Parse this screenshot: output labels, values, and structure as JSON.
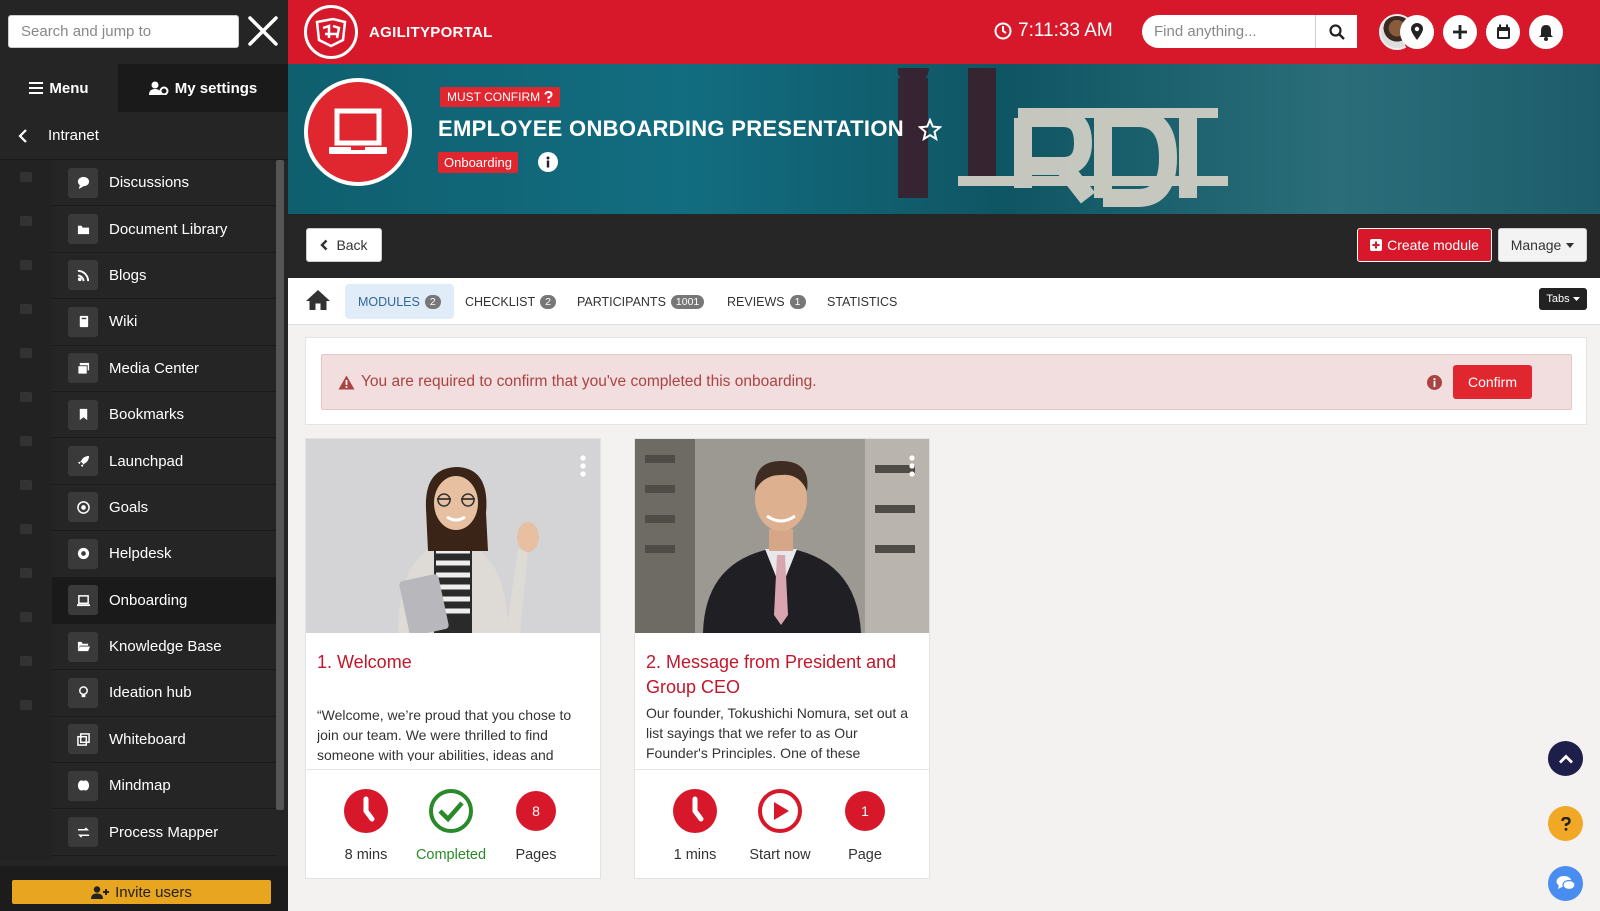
{
  "sidebar": {
    "search_placeholder": "Search and jump to",
    "tab_menu": "Menu",
    "tab_settings": "My settings",
    "breadcrumb": "Intranet",
    "items": [
      {
        "label": "Discussions",
        "icon": "chat-bubble-icon"
      },
      {
        "label": "Document Library",
        "icon": "folder-icon"
      },
      {
        "label": "Blogs",
        "icon": "rss-icon"
      },
      {
        "label": "Wiki",
        "icon": "book-icon"
      },
      {
        "label": "Media Center",
        "icon": "images-icon"
      },
      {
        "label": "Bookmarks",
        "icon": "bookmark-icon"
      },
      {
        "label": "Launchpad",
        "icon": "rocket-icon"
      },
      {
        "label": "Goals",
        "icon": "target-icon"
      },
      {
        "label": "Helpdesk",
        "icon": "lifebuoy-icon"
      },
      {
        "label": "Onboarding",
        "icon": "laptop-icon",
        "active": true
      },
      {
        "label": "Knowledge Base",
        "icon": "folder-open-icon"
      },
      {
        "label": "Ideation hub",
        "icon": "lightbulb-icon"
      },
      {
        "label": "Whiteboard",
        "icon": "clone-icon"
      },
      {
        "label": "Mindmap",
        "icon": "brain-icon"
      },
      {
        "label": "Process Mapper",
        "icon": "exchange-icon"
      }
    ],
    "invite_label": "Invite users"
  },
  "topbar": {
    "brand": "AGILITYPORTAL",
    "time": "7:11:33 AM",
    "search_placeholder": "Find anything..."
  },
  "hero": {
    "badge_confirm": "MUST CONFIRM",
    "title": "EMPLOYEE ONBOARDING PRESENTATION",
    "category": "Onboarding"
  },
  "actions": {
    "back": "Back",
    "create": "Create module",
    "manage": "Manage"
  },
  "tabs": [
    {
      "label": "MODULES",
      "count": "2"
    },
    {
      "label": "CHECKLIST",
      "count": "2"
    },
    {
      "label": "PARTICIPANTS",
      "count": "1001"
    },
    {
      "label": "REVIEWS",
      "count": "1"
    },
    {
      "label": "STATISTICS",
      "count": ""
    }
  ],
  "tabs_dropdown": "Tabs",
  "alert": {
    "message": "You are required to confirm that you've completed this onboarding.",
    "confirm": "Confirm"
  },
  "modules": [
    {
      "title": "1. Welcome",
      "text": "“Welcome, we’re proud that you chose to join our team. We were thrilled to find someone with your abilities, ideas and enthusiasm.",
      "duration": "8 mins",
      "status": "Completed",
      "pages_count": "8",
      "pages_label": "Pages"
    },
    {
      "title": "2. Message from President and Group CEO",
      "text": "Our founder, Tokushichi Nomura, set out a list sayings that we refer to as Our Founder's Principles. One of these principles reads as follows.",
      "duration": "1 mins",
      "status": "Start now",
      "pages_count": "1",
      "pages_label": "Page"
    }
  ],
  "colors": {
    "brand_red": "#d7182a",
    "sidebar_bg": "#252525",
    "completed_green": "#2a8a2a",
    "invite_yellow": "#e8a51f"
  }
}
